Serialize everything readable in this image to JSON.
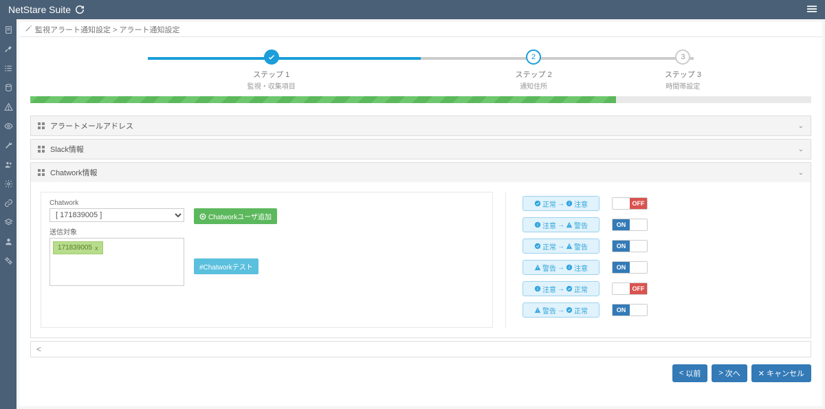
{
  "header": {
    "brand": "NetStare Suite"
  },
  "breadcrumb": {
    "path": "監視アラート通知設定 > アラート通知設定"
  },
  "stepper": {
    "steps": [
      {
        "title": "ステップ 1",
        "sub": "監視・収集項目",
        "state": "done"
      },
      {
        "title": "ステップ 2",
        "sub": "通知住所",
        "state": "active"
      },
      {
        "title": "ステップ 3",
        "sub": "時間帯設定",
        "state": "pending"
      }
    ],
    "progress_percent": 75
  },
  "panels": {
    "mail": {
      "title": "アラートメールアドレス"
    },
    "slack": {
      "title": "Slack情報"
    },
    "chatwork": {
      "title": "Chatwork情報",
      "chatwork_label": "Chatwork",
      "selected": "[ 171839005 ]",
      "add_user_btn": "Chatworkユーザ追加",
      "send_target_label": "送信対象",
      "tag_value": "171839005",
      "test_btn": "#Chatworkテスト"
    }
  },
  "states": {
    "rows": [
      {
        "from_icon": "check",
        "from": "正常",
        "to_icon": "info",
        "to": "注意",
        "toggle": "off"
      },
      {
        "from_icon": "info",
        "from": "注意",
        "to_icon": "warn",
        "to": "警告",
        "toggle": "on"
      },
      {
        "from_icon": "check",
        "from": "正常",
        "to_icon": "warn",
        "to": "警告",
        "toggle": "on"
      },
      {
        "from_icon": "warn",
        "from": "警告",
        "to_icon": "info",
        "to": "注意",
        "toggle": "on"
      },
      {
        "from_icon": "info",
        "from": "注意",
        "to_icon": "check",
        "to": "正常",
        "toggle": "off"
      },
      {
        "from_icon": "warn",
        "from": "警告",
        "to_icon": "check",
        "to": "正常",
        "toggle": "on"
      }
    ],
    "arrow": "→",
    "on_label": "ON",
    "off_label": "OFF"
  },
  "actions": {
    "prev": "以前",
    "next": "次へ",
    "cancel": "キャンセル"
  }
}
